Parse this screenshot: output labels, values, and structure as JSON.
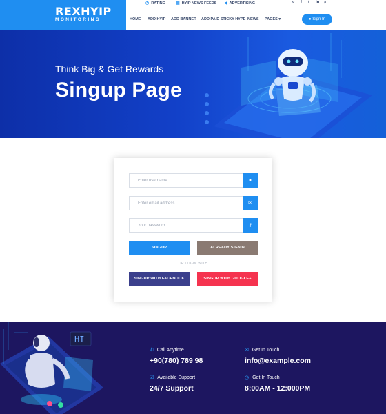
{
  "logo": {
    "title": "REXHYIP",
    "subtitle": "MONITORING"
  },
  "top_links": [
    {
      "icon": "clock-icon",
      "label": "RATING"
    },
    {
      "icon": "feed-icon",
      "label": "HYIP NEWS FEEDS"
    },
    {
      "icon": "megaphone-icon",
      "label": "ADVERTISING"
    }
  ],
  "social": [
    "vimeo-icon",
    "facebook-icon",
    "twitter-icon",
    "linkedin-icon",
    "search-icon"
  ],
  "nav": [
    "HOME",
    "ADD HYIP",
    "ADD BANNER",
    "ADD PAID STICKY HYPE",
    "NEWS",
    "PAGES"
  ],
  "signin_label": "Sign In",
  "hero": {
    "subtitle": "Think Big & Get Rewards",
    "title": "Singup Page"
  },
  "form": {
    "username_placeholder": "Enter username",
    "email_placeholder": "Enter email address",
    "password_placeholder": "Your password",
    "signup_label": "SINGUP",
    "already_label": "ALREADY SIGNIN",
    "or_text": "OR LOGIN WITH",
    "facebook_label": "SINGUP WITH FACEBOOK",
    "google_label": "SINGUP WITH GOOGLE+",
    "colors": {
      "primary": "#1f8ef1",
      "already": "#8a7a72",
      "facebook": "#3b3f8c",
      "google": "#f5334f"
    }
  },
  "footer": {
    "robot_bubble": "HI",
    "call_label": "Call Anytime",
    "call_value": "+90(780) 789 98",
    "touch_label": "Get In Touch",
    "touch_value": "info@example.com",
    "support_label": "Available Support",
    "support_value": "24/7 Support",
    "hours_label": "Get In Touch",
    "hours_value": "8:00AM - 12:000PM"
  }
}
